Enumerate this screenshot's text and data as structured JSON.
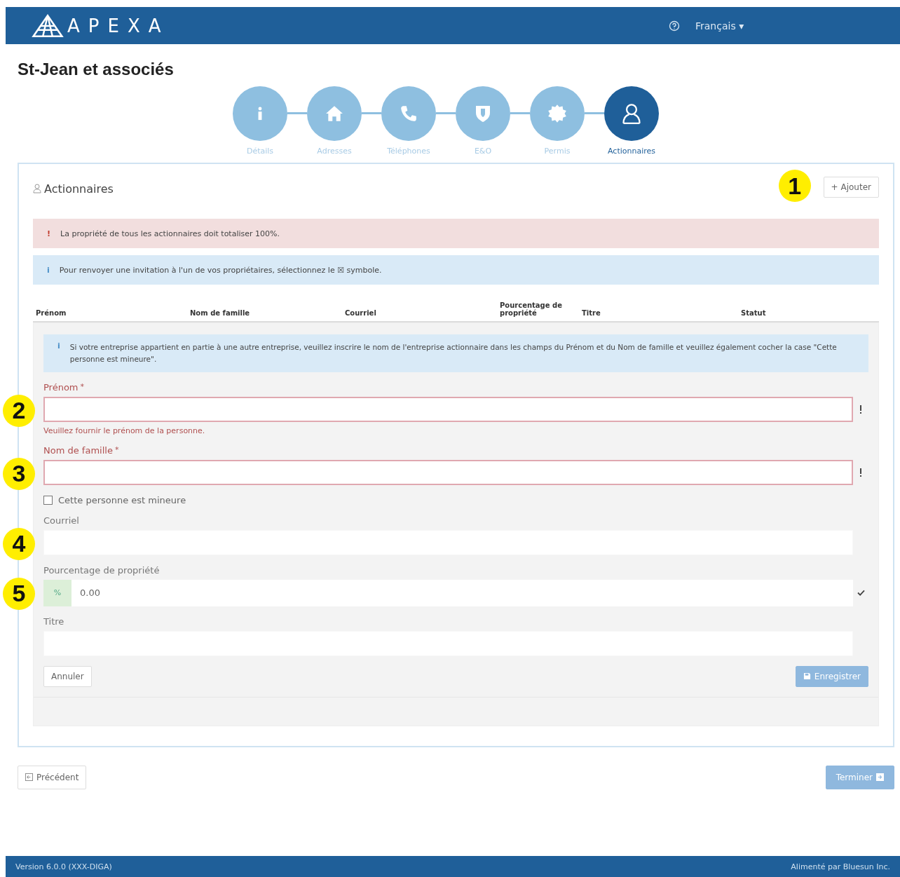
{
  "header": {
    "logo": "APEXA",
    "language": "Français ▾"
  },
  "company": "St-Jean et associés",
  "steps": [
    {
      "kind": "info",
      "label": "Détails",
      "selected": false
    },
    {
      "kind": "home",
      "label": "Adresses",
      "selected": false
    },
    {
      "kind": "phone",
      "label": "Téléphones",
      "selected": false
    },
    {
      "kind": "shield",
      "label": "E&O",
      "selected": false
    },
    {
      "kind": "badge",
      "label": "Permis",
      "selected": false
    },
    {
      "kind": "user",
      "label": "Actionnaires",
      "selected": true
    }
  ],
  "panel": {
    "title": "Actionnaires",
    "add_button": {
      "label": "+ Ajouter",
      "marker": "1"
    },
    "alerts": [
      {
        "kind": "danger",
        "icon": "!",
        "text": "La propriété de tous les actionnaires doit totaliser 100%."
      },
      {
        "kind": "info",
        "icon": "i",
        "text": "Pour renvoyer une invitation à l'un de vos propriétaires, sélectionnez le ☒ symbole."
      }
    ],
    "columns": [
      "Prénom",
      "Nom de famille",
      "Courriel",
      "Pourcentage de propriété",
      "Titre",
      "Statut"
    ],
    "form": {
      "notice": {
        "icon": "i",
        "text": "Si votre entreprise appartient en partie à une autre entreprise, veuillez inscrire le nom de l'entreprise actionnaire dans les champs du Prénom et du Nom de famille et veuillez également cocher la case \"Cette personne est mineure\"."
      },
      "fields": [
        {
          "kind": "text",
          "label": "Prénom",
          "required_mark": "*",
          "invalid": true,
          "error": "Veuillez fournir le prénom de la personne.",
          "marker": "2"
        },
        {
          "kind": "text",
          "label": "Nom de famille",
          "required_mark": "*",
          "invalid": true,
          "marker": "3"
        },
        {
          "kind": "checkbox",
          "label": "Cette personne est mineure",
          "checked": false
        },
        {
          "kind": "text",
          "label": "Courriel",
          "invalid": false,
          "marker": "4"
        },
        {
          "kind": "percent",
          "label": "Pourcentage de propriété",
          "addon": "%",
          "value": "0.00",
          "valid": true,
          "marker": "5"
        },
        {
          "kind": "text",
          "label": "Titre",
          "invalid": false
        }
      ],
      "cancel": "Annuler",
      "save": "Enregistrer"
    }
  },
  "nav": {
    "previous": "Précédent",
    "finish": "Terminer"
  },
  "footer": {
    "version": "Version 6.0.0 (XXX-DIGA)",
    "powered": "Alimenté par Bluesun Inc."
  }
}
